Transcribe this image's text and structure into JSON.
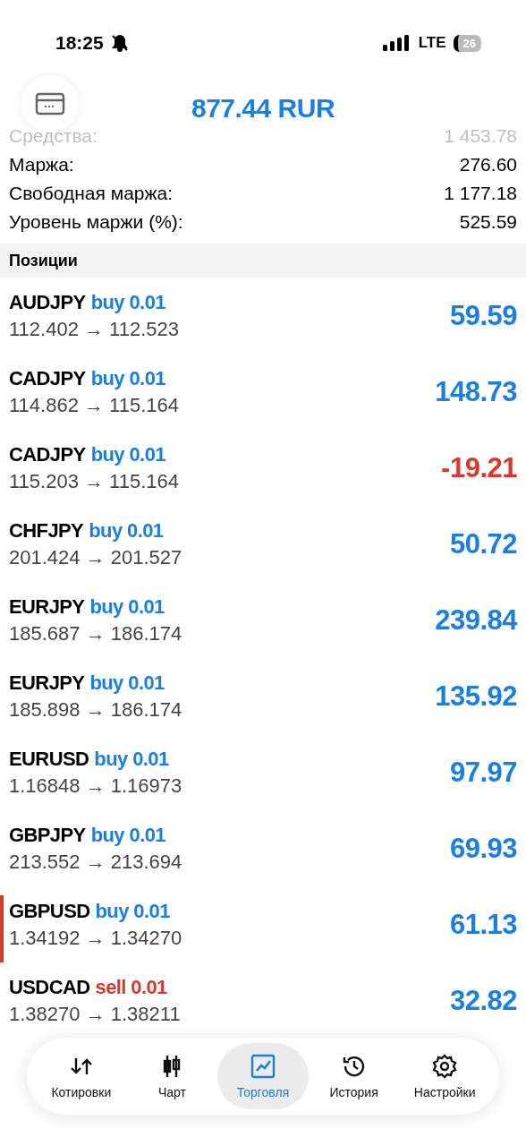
{
  "status_bar": {
    "time": "18:25",
    "network": "LTE",
    "battery": "26"
  },
  "header": {
    "title": "877.44 RUR"
  },
  "summary": [
    {
      "label": "Средства:",
      "value": "1 453.78",
      "faded": true
    },
    {
      "label": "Маржа:",
      "value": "276.60",
      "faded": false
    },
    {
      "label": "Свободная маржа:",
      "value": "1 177.18",
      "faded": false
    },
    {
      "label": "Уровень маржи (%):",
      "value": "525.59",
      "faded": false
    }
  ],
  "section_title": "Позиции",
  "positions": [
    {
      "symbol": "AUDJPY",
      "order": "buy 0.01",
      "kind": "buy",
      "prices": "112.402 → 112.523",
      "profit": "59.59",
      "loss": false,
      "highlighted": false
    },
    {
      "symbol": "CADJPY",
      "order": "buy 0.01",
      "kind": "buy",
      "prices": "114.862 → 115.164",
      "profit": "148.73",
      "loss": false,
      "highlighted": false
    },
    {
      "symbol": "CADJPY",
      "order": "buy 0.01",
      "kind": "buy",
      "prices": "115.203 → 115.164",
      "profit": "-19.21",
      "loss": true,
      "highlighted": false
    },
    {
      "symbol": "CHFJPY",
      "order": "buy 0.01",
      "kind": "buy",
      "prices": "201.424 → 201.527",
      "profit": "50.72",
      "loss": false,
      "highlighted": false
    },
    {
      "symbol": "EURJPY",
      "order": "buy 0.01",
      "kind": "buy",
      "prices": "185.687 → 186.174",
      "profit": "239.84",
      "loss": false,
      "highlighted": false
    },
    {
      "symbol": "EURJPY",
      "order": "buy 0.01",
      "kind": "buy",
      "prices": "185.898 → 186.174",
      "profit": "135.92",
      "loss": false,
      "highlighted": false
    },
    {
      "symbol": "EURUSD",
      "order": "buy 0.01",
      "kind": "buy",
      "prices": "1.16848 → 1.16973",
      "profit": "97.97",
      "loss": false,
      "highlighted": false
    },
    {
      "symbol": "GBPJPY",
      "order": "buy 0.01",
      "kind": "buy",
      "prices": "213.552 → 213.694",
      "profit": "69.93",
      "loss": false,
      "highlighted": false
    },
    {
      "symbol": "GBPUSD",
      "order": "buy 0.01",
      "kind": "buy",
      "prices": "1.34192 → 1.34270",
      "profit": "61.13",
      "loss": false,
      "highlighted": true
    },
    {
      "symbol": "USDCAD",
      "order": "sell 0.01",
      "kind": "sell",
      "prices": "1.38270 → 1.38211",
      "profit": "32.82",
      "loss": false,
      "highlighted": false
    }
  ],
  "tab_bar": [
    {
      "label": "Котировки",
      "selected": false
    },
    {
      "label": "Чарт",
      "selected": false
    },
    {
      "label": "Торговля",
      "selected": true
    },
    {
      "label": "История",
      "selected": false
    },
    {
      "label": "Настройки",
      "selected": false
    }
  ]
}
